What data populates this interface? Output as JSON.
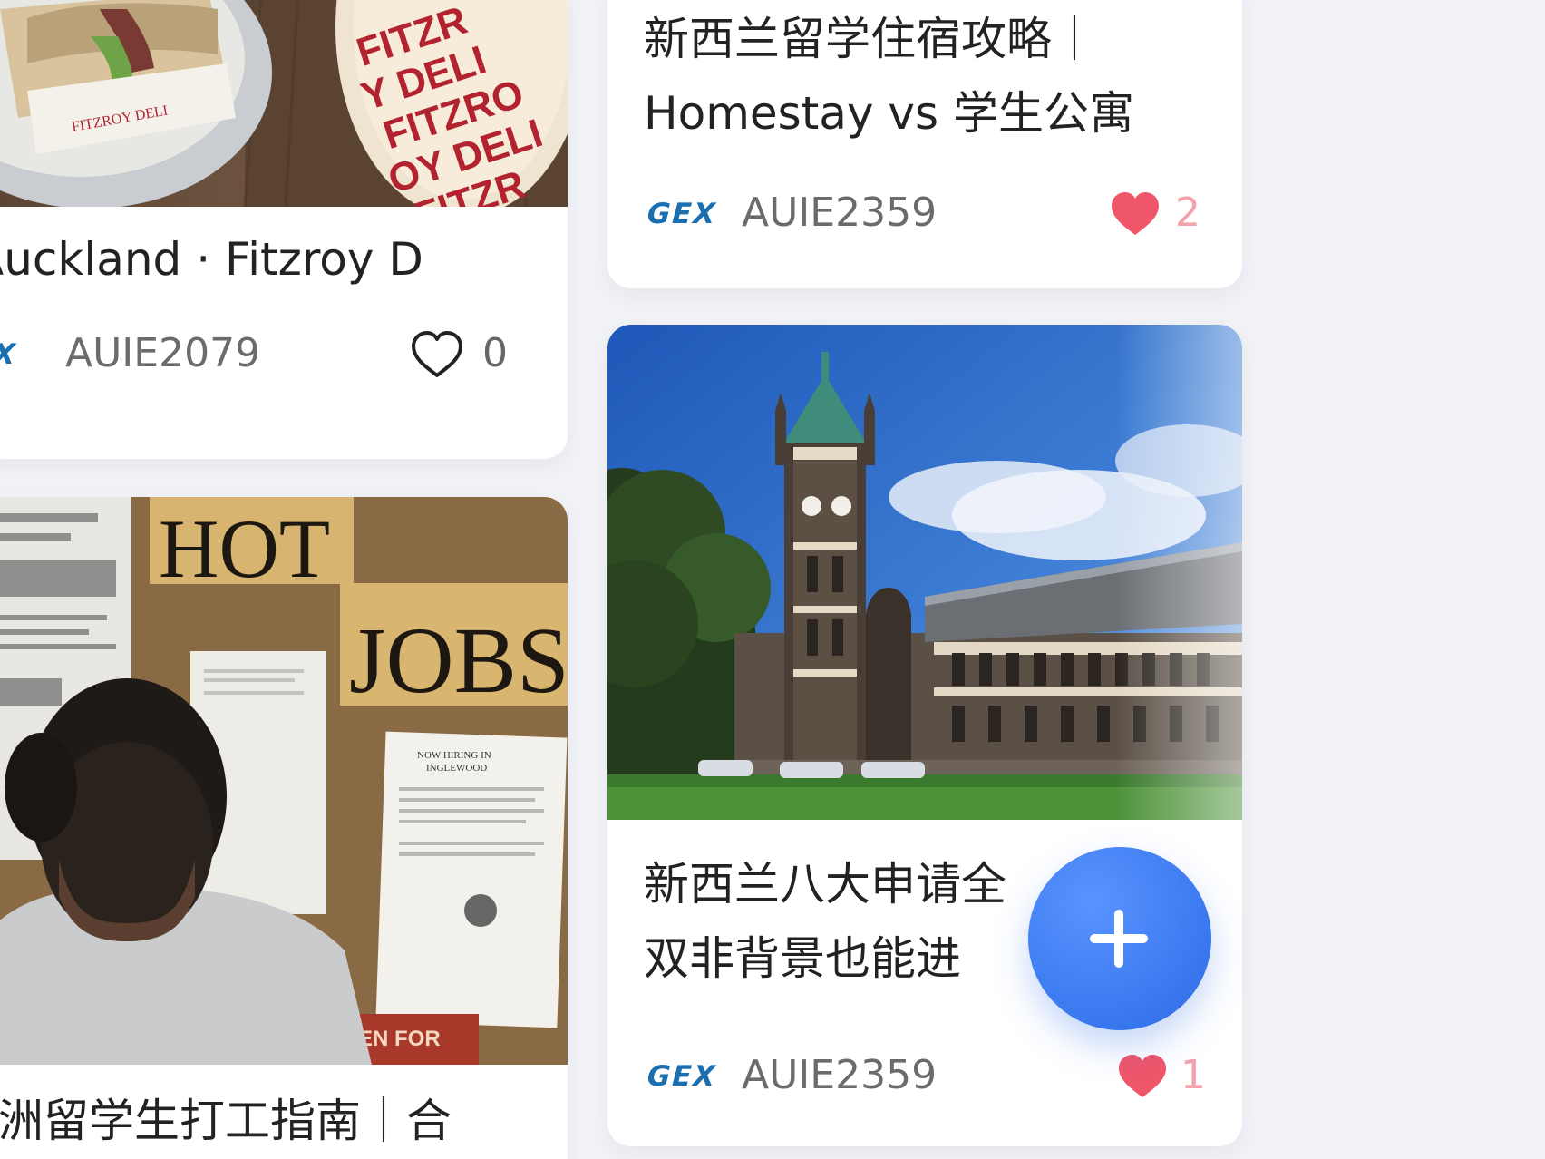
{
  "feed": {
    "cards": [
      {
        "title_lines": [
          "Auckland · Fitzroy D"
        ],
        "author": "AUIE2079",
        "brand": "GEX",
        "likes": "0",
        "liked": false
      },
      {
        "title_lines": [
          "澳洲留学生打工指南｜合"
        ],
        "photo_caption": "HOT JOBS",
        "photo_notice": "NOW HIRING IN INGLEWOOD"
      },
      {
        "title_lines": [
          "新西兰留学住宿攻略｜",
          "Homestay vs 学生公寓"
        ],
        "author": "AUIE2359",
        "brand": "GEX",
        "likes": "2",
        "liked": true
      },
      {
        "title_lines": [
          "新西兰八大申请全",
          "双非背景也能进"
        ],
        "author": "AUIE2359",
        "brand": "GEX",
        "likes": "1",
        "liked": true
      }
    ],
    "food_cup_text": "FITZROY DELI"
  },
  "fab": {
    "icon": "plus-icon",
    "label": "+"
  },
  "colors": {
    "background": "#f1f2f6",
    "card": "#ffffff",
    "brand_blue": "#1a6fb0",
    "heart_red": "#f0566a",
    "like_pink": "#f5a1ab",
    "fab_blue": "#3f7ef2"
  }
}
